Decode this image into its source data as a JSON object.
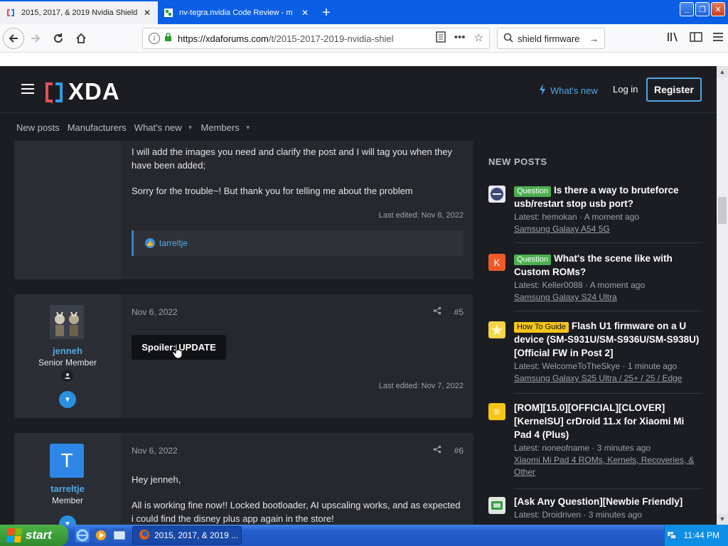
{
  "browser": {
    "tabs": [
      {
        "title": "2015, 2017, & 2019 Nvidia Shield",
        "active": true
      },
      {
        "title": "nv-tegra.nvidia Code Review - m",
        "active": false
      }
    ],
    "url_host": "https://xdaforums.com",
    "url_path": "/t/2015-2017-2019-nvidia-shiel",
    "search_value": "shield firmware"
  },
  "xda": {
    "logo_text": "XDA",
    "whats_new": "What's new",
    "login": "Log in",
    "register": "Register",
    "subnav": [
      "New posts",
      "Manufacturers",
      "What's new",
      "Members"
    ]
  },
  "posts": {
    "p4": {
      "line1": "I will add the images you need and clarify the post and I will tag you when they have been added;",
      "line2": "Sorry for the trouble~! But thank you for telling me about the problem",
      "edited": "Last edited: Nov 8, 2022",
      "reaction_user": "tarreltje"
    },
    "p5": {
      "date": "Nov 6, 2022",
      "number": "#5",
      "username": "jenneh",
      "user_title": "Senior Member",
      "spoiler": "Spoiler: UPDATE",
      "edited": "Last edited: Nov 7, 2022"
    },
    "p6": {
      "date": "Nov 6, 2022",
      "number": "#6",
      "avatar_letter": "T",
      "username": "tarreltje",
      "user_title": "Member",
      "greeting": "Hey jenneh,",
      "body": "All is working fine now!! Locked bootloader, AI upscaling works, and as expected i could find the disney plus app again in the store!"
    }
  },
  "sidebar": {
    "heading": "NEW POSTS",
    "items": [
      {
        "badge": "Question",
        "title": "Is there a way to bruteforce usb/restart stop usb port?",
        "latest": "Latest: hemokan · A moment ago",
        "forum": "Samsung Galaxy A54 5G"
      },
      {
        "badge": "Question",
        "title": "What's the scene like with Custom ROMs?",
        "latest": "Latest: Keller0088 · A moment ago",
        "forum": "Samsung Galaxy S24 Ultra",
        "icon_letter": "K"
      },
      {
        "badge": "How To Guide",
        "title": "Flash U1 firmware on a U device (SM-S931U/SM-S936U/SM-S938U) [Official FW in Post 2]",
        "latest": "Latest: WelcomeToTheSkye · 1 minute ago",
        "forum": "Samsung Galaxy S25 Ultra / 25+ / 25 / Edge"
      },
      {
        "badge": "",
        "title": "[ROM][15.0][OFFICIAL][CLOVER][KernelSU] crDroid 11.x for Xiaomi Mi Pad 4 (Plus)",
        "latest": "Latest: noneofname · 3 minutes ago",
        "forum": "Xiaomi Mi Pad 4 ROMs, Kernels, Recoveries, & Other"
      },
      {
        "badge": "",
        "title": "[Ask Any Question][Newbie Friendly]",
        "latest": "Latest: Droidriven · 3 minutes ago",
        "forum": ""
      }
    ]
  },
  "taskbar": {
    "start": "start",
    "task_item": "2015, 2017, & 2019 ...",
    "clock": "11:44 PM"
  },
  "colors": {
    "accent_blue": "#4fa8e6",
    "question_badge": "#4caf50",
    "guide_badge": "#f5c518"
  }
}
